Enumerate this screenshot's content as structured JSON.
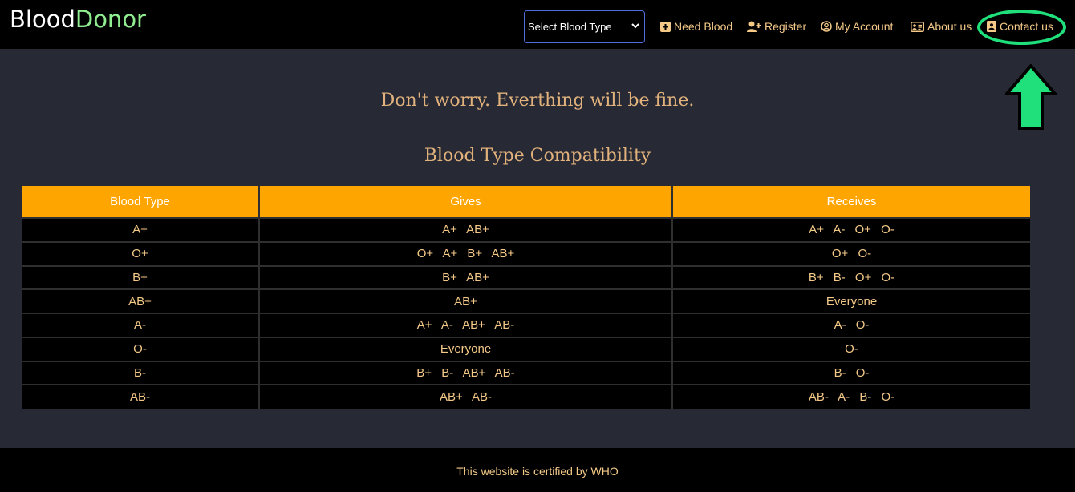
{
  "navbar": {
    "brand_part1": "Blood",
    "brand_part2": "Donor",
    "select_value": "Select Blood Type",
    "links": {
      "need_blood": "Need Blood",
      "register": "Register",
      "my_account": "My Account",
      "about_us": "About us",
      "contact_us": "Contact us"
    }
  },
  "main": {
    "tagline": "Don't worry. Everthing will be fine.",
    "title": "Blood Type Compatibility",
    "table": {
      "headers": [
        "Blood Type",
        "Gives",
        "Receives"
      ],
      "rows": [
        [
          "A+",
          "A+ AB+",
          "A+ A- O+ O-"
        ],
        [
          "O+",
          "O+ A+ B+ AB+",
          "O+ O-"
        ],
        [
          "B+",
          "B+ AB+",
          "B+ B- O+ O-"
        ],
        [
          "AB+",
          "AB+",
          "Everyone"
        ],
        [
          "A-",
          "A+ A- AB+ AB-",
          "A- O-"
        ],
        [
          "O-",
          "Everyone",
          "O-"
        ],
        [
          "B-",
          "B+ B- AB+ AB-",
          "B- O-"
        ],
        [
          "AB-",
          "AB+ AB-",
          "AB- A- B- O-"
        ]
      ]
    }
  },
  "footer": {
    "text": "This website is certified by WHO"
  },
  "colors": {
    "background": "#272935",
    "navbar": "#000000",
    "accent": "#ffa500",
    "text_gold": "#f4c988",
    "brand_green": "#90ee90",
    "highlight": "#1fe07a"
  },
  "icons": {
    "need_blood": "plus-square-icon",
    "register": "user-plus-icon",
    "my_account": "user-circle-icon",
    "about_us": "id-card-icon",
    "contact_us": "address-book-icon"
  }
}
